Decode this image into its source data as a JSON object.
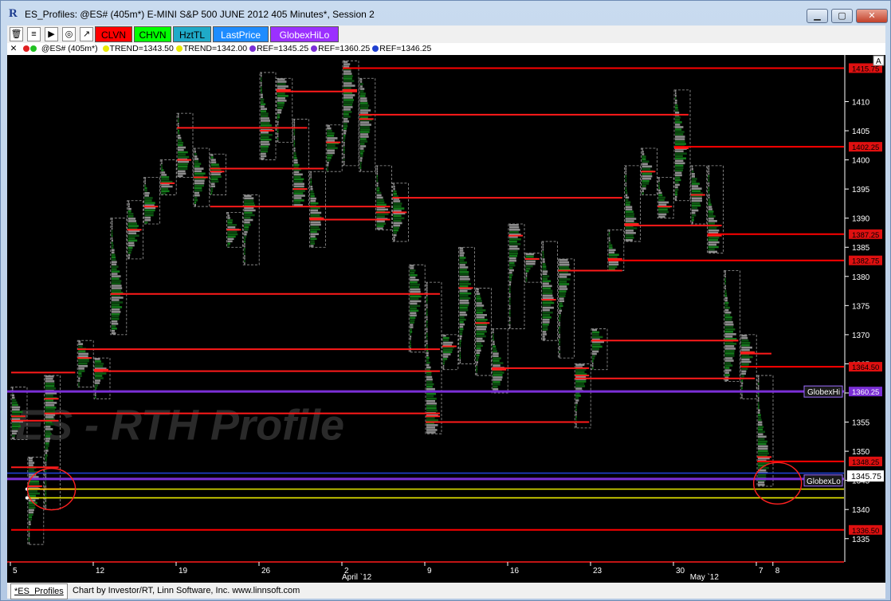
{
  "window": {
    "title": "ES_Profiles: @ES# (405m*) E-MINI S&P 500 JUNE 2012 405 Minutes*, Session 2",
    "app_icon": "R",
    "minimize_label": "▁",
    "maximize_label": "▢",
    "close_label": "✕"
  },
  "toolbar": {
    "icons": [
      {
        "name": "trash-icon",
        "glyph": "🗑"
      },
      {
        "name": "bar-chart-icon",
        "glyph": "≡"
      },
      {
        "name": "play-flag-icon",
        "glyph": "▶"
      },
      {
        "name": "clock-icon",
        "glyph": "◎"
      },
      {
        "name": "ttl-chart-icon",
        "glyph": "↗"
      }
    ],
    "buttons": [
      {
        "name": "clvn-button",
        "label": "CLVN",
        "bg": "#ff0000",
        "fg": "#000000"
      },
      {
        "name": "chvn-button",
        "label": "CHVN",
        "bg": "#00ff00",
        "fg": "#000000"
      },
      {
        "name": "hztl-button",
        "label": "HztTL",
        "bg": "#1faac8",
        "fg": "#000000"
      },
      {
        "name": "lastprice-button",
        "label": "LastPrice",
        "bg": "#1e8cff",
        "fg": "#ffffff"
      },
      {
        "name": "globexhilo-button",
        "label": "GlobexHiLo",
        "bg": "#9b30ff",
        "fg": "#ffffff"
      }
    ]
  },
  "infobar": {
    "close_glyph": "✕",
    "symbol": "@ES# (405m*)",
    "items": [
      {
        "name": "trend-1",
        "text": "TREND=1343.50",
        "color": "#e8e800"
      },
      {
        "name": "trend-2",
        "text": "TREND=1342.00",
        "color": "#e8e800"
      },
      {
        "name": "ref-1",
        "text": "REF=1345.25",
        "color": "#7b2fd6"
      },
      {
        "name": "ref-2",
        "text": "REF=1360.25",
        "color": "#7b2fd6"
      },
      {
        "name": "ref-3",
        "text": "REF=1346.25",
        "color": "#2040d0"
      }
    ]
  },
  "chart_data": {
    "type": "table",
    "watermark": "ES - RTH Profile",
    "ylim": [
      1331,
      1418
    ],
    "y_ticks": [
      1335,
      1340,
      1345,
      1350,
      1355,
      1360,
      1365,
      1370,
      1375,
      1380,
      1385,
      1390,
      1395,
      1400,
      1405,
      1410
    ],
    "x_ticks": [
      {
        "label": "5",
        "x": 0
      },
      {
        "label": "12",
        "x": 5
      },
      {
        "label": "19",
        "x": 10
      },
      {
        "label": "26",
        "x": 15
      },
      {
        "label": "2",
        "x": 20
      },
      {
        "label": "9",
        "x": 25
      },
      {
        "label": "16",
        "x": 30
      },
      {
        "label": "23",
        "x": 35
      },
      {
        "label": "30",
        "x": 40
      },
      {
        "label": "7",
        "x": 45
      },
      {
        "label": "8",
        "x": 46
      }
    ],
    "x_sublabels": [
      {
        "label": "April `12",
        "x": 20
      },
      {
        "label": "May `12",
        "x": 41
      }
    ],
    "autoscale_label": "A",
    "profiles": [
      {
        "x": 0,
        "low": 1352,
        "high": 1361,
        "poc": 1356
      },
      {
        "x": 1,
        "low": 1334,
        "high": 1349,
        "poc": 1344
      },
      {
        "x": 2,
        "low": 1340,
        "high": 1363,
        "poc": 1359
      },
      {
        "x": 4,
        "low": 1361,
        "high": 1369,
        "poc": 1366
      },
      {
        "x": 5,
        "low": 1359,
        "high": 1366,
        "poc": 1364
      },
      {
        "x": 6,
        "low": 1370,
        "high": 1390,
        "poc": 1377
      },
      {
        "x": 7,
        "low": 1383,
        "high": 1393,
        "poc": 1388
      },
      {
        "x": 8,
        "low": 1389,
        "high": 1397,
        "poc": 1392
      },
      {
        "x": 9,
        "low": 1394,
        "high": 1400,
        "poc": 1396
      },
      {
        "x": 10,
        "low": 1397,
        "high": 1408,
        "poc": 1400
      },
      {
        "x": 11,
        "low": 1392,
        "high": 1402,
        "poc": 1397
      },
      {
        "x": 12,
        "low": 1394,
        "high": 1401,
        "poc": 1398
      },
      {
        "x": 13,
        "low": 1385,
        "high": 1391,
        "poc": 1388
      },
      {
        "x": 14,
        "low": 1382,
        "high": 1394,
        "poc": 1392
      },
      {
        "x": 15,
        "low": 1400,
        "high": 1415,
        "poc": 1405
      },
      {
        "x": 16,
        "low": 1403,
        "high": 1414,
        "poc": 1412
      },
      {
        "x": 17,
        "low": 1392,
        "high": 1407,
        "poc": 1395
      },
      {
        "x": 18,
        "low": 1385,
        "high": 1398,
        "poc": 1390
      },
      {
        "x": 19,
        "low": 1398,
        "high": 1406,
        "poc": 1403
      },
      {
        "x": 20,
        "low": 1399,
        "high": 1417,
        "poc": 1412
      },
      {
        "x": 21,
        "low": 1398,
        "high": 1414,
        "poc": 1407
      },
      {
        "x": 22,
        "low": 1388,
        "high": 1399,
        "poc": 1391
      },
      {
        "x": 23,
        "low": 1386,
        "high": 1396,
        "poc": 1391
      },
      {
        "x": 24,
        "low": 1367,
        "high": 1382,
        "poc": 1377
      },
      {
        "x": 25,
        "low": 1353,
        "high": 1379,
        "poc": 1356
      },
      {
        "x": 26,
        "low": 1364,
        "high": 1370,
        "poc": 1368
      },
      {
        "x": 27,
        "low": 1365,
        "high": 1385,
        "poc": 1378
      },
      {
        "x": 28,
        "low": 1363,
        "high": 1378,
        "poc": 1372
      },
      {
        "x": 29,
        "low": 1360,
        "high": 1371,
        "poc": 1364
      },
      {
        "x": 30,
        "low": 1371,
        "high": 1389,
        "poc": 1387
      },
      {
        "x": 31,
        "low": 1379,
        "high": 1384,
        "poc": 1383
      },
      {
        "x": 32,
        "low": 1369,
        "high": 1386,
        "poc": 1376
      },
      {
        "x": 33,
        "low": 1366,
        "high": 1383,
        "poc": 1381
      },
      {
        "x": 34,
        "low": 1354,
        "high": 1365,
        "poc": 1363
      },
      {
        "x": 35,
        "low": 1364,
        "high": 1371,
        "poc": 1369
      },
      {
        "x": 36,
        "low": 1381,
        "high": 1388,
        "poc": 1383
      },
      {
        "x": 37,
        "low": 1386,
        "high": 1399,
        "poc": 1389
      },
      {
        "x": 38,
        "low": 1394,
        "high": 1402,
        "poc": 1398
      },
      {
        "x": 39,
        "low": 1390,
        "high": 1397,
        "poc": 1392
      },
      {
        "x": 40,
        "low": 1393,
        "high": 1412,
        "poc": 1402
      },
      {
        "x": 41,
        "low": 1389,
        "high": 1399,
        "poc": 1394
      },
      {
        "x": 42,
        "low": 1384,
        "high": 1399,
        "poc": 1387
      },
      {
        "x": 43,
        "low": 1362,
        "high": 1381,
        "poc": 1369
      },
      {
        "x": 44,
        "low": 1359,
        "high": 1370,
        "poc": 1367
      },
      {
        "x": 45,
        "low": 1344,
        "high": 1363,
        "poc": 1349
      }
    ],
    "poc_lines": [
      {
        "price": 1363.5,
        "from": 0,
        "to": 3
      },
      {
        "price": 1355.25,
        "from": 0,
        "to": 2
      },
      {
        "price": 1343.5,
        "from": 1,
        "to": 3
      },
      {
        "price": 1367.5,
        "from": 4,
        "to": 25
      },
      {
        "price": 1363.75,
        "from": 5,
        "to": 25
      },
      {
        "price": 1356.5,
        "from": 2,
        "to": 25
      },
      {
        "price": 1355,
        "from": 25,
        "to": 34
      },
      {
        "price": 1377,
        "from": 6,
        "to": 25
      },
      {
        "price": 1392,
        "from": 12,
        "to": 22
      },
      {
        "price": 1405.5,
        "from": 10,
        "to": 17
      },
      {
        "price": 1398.5,
        "from": 12,
        "to": 18
      },
      {
        "price": 1389.75,
        "from": 18,
        "to": 22
      },
      {
        "price": 1411.75,
        "from": 16,
        "to": 20
      },
      {
        "price": 1393.5,
        "from": 23,
        "to": 36
      },
      {
        "price": 1364.25,
        "from": 29,
        "to": 34
      },
      {
        "price": 1381,
        "from": 33,
        "to": 36
      },
      {
        "price": 1362.5,
        "from": 34,
        "to": 44
      },
      {
        "price": 1369,
        "from": 35,
        "to": 43
      },
      {
        "price": 1388.75,
        "from": 37,
        "to": 42
      },
      {
        "price": 1407.75,
        "from": 21,
        "to": 40
      },
      {
        "price": 1366.75,
        "from": 44,
        "to": 45
      },
      {
        "price": 1347.25,
        "from": 0,
        "to": 2
      }
    ],
    "levels": [
      {
        "price": 1415.75,
        "label": "1415.75",
        "from": 20,
        "color": "#ff0000"
      },
      {
        "price": 1402.25,
        "label": "1402.25",
        "from": 40,
        "color": "#ff0000"
      },
      {
        "price": 1387.25,
        "label": "1387.25",
        "from": 42,
        "color": "#ff0000"
      },
      {
        "price": 1382.75,
        "label": "1382.75",
        "from": 36,
        "color": "#ff0000"
      },
      {
        "price": 1364.5,
        "label": "1364.50",
        "from": 44,
        "color": "#ff0000"
      },
      {
        "price": 1348.25,
        "label": "1348.25",
        "from": 45,
        "color": "#ff0000"
      },
      {
        "price": 1336.5,
        "label": "1336.50",
        "from": 0,
        "color": "#ff0000"
      }
    ],
    "globex_hi": {
      "price": 1360.25,
      "label": "GlobexHi",
      "value_label": "1360.25",
      "color": "#7b2fd6"
    },
    "globex_lo": {
      "price": 1345.25,
      "label": "GlobexLo",
      "color": "#7b2fd6"
    },
    "ref_line": {
      "price": 1346.25,
      "color": "#2040d0"
    },
    "trend_lines": [
      {
        "price": 1343.5,
        "color": "#e8e800"
      },
      {
        "price": 1342.0,
        "color": "#e8e800"
      }
    ],
    "last_price": {
      "price": 1345.75,
      "label": "1345.75",
      "color": "#ffffff"
    },
    "annotations": [
      {
        "shape": "ellipse",
        "x": 2,
        "price": 1343.5,
        "color": "#ff2020"
      },
      {
        "shape": "ellipse",
        "x": 45.8,
        "price": 1344.5,
        "color": "#ff2020"
      }
    ]
  },
  "status": {
    "tab": "*ES_Profiles",
    "credit": "Chart by Investor/RT, Linn Software, Inc.  www.linnsoft.com"
  }
}
